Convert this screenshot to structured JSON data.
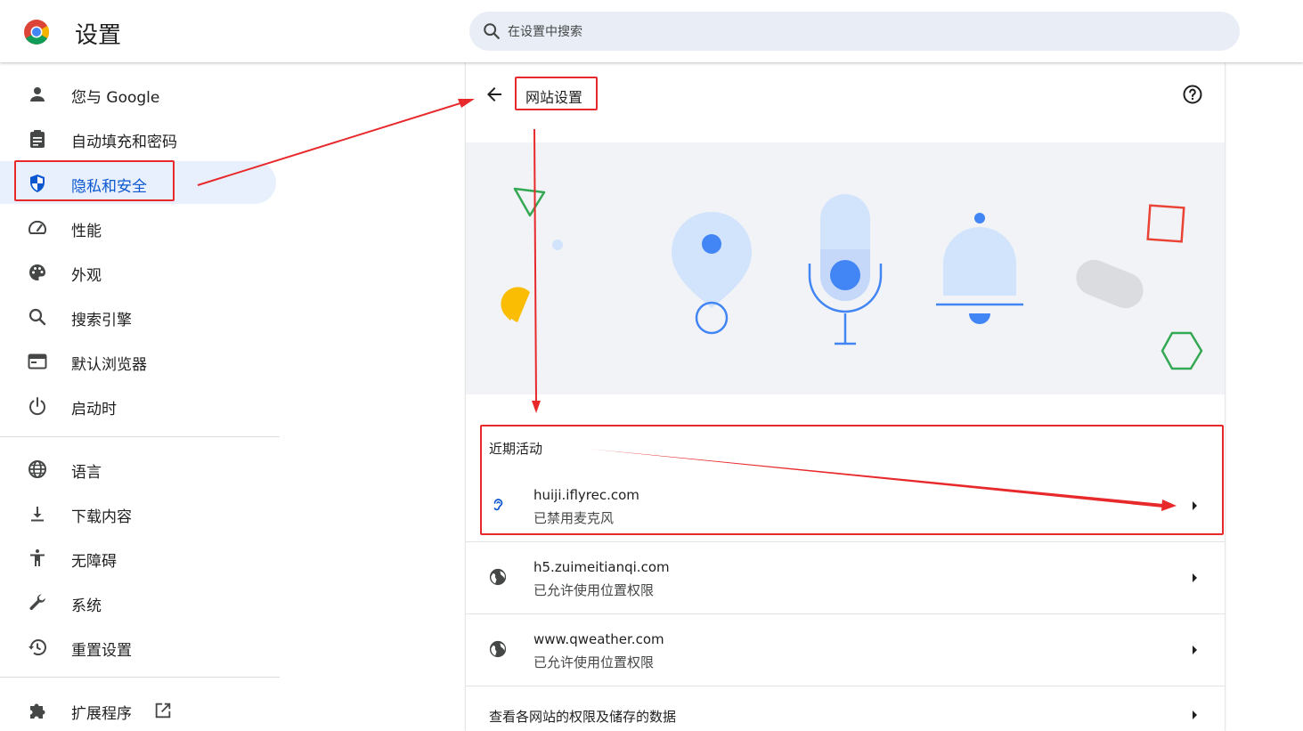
{
  "header": {
    "title": "设置",
    "search_placeholder": "在设置中搜索",
    "logo_icon": "chrome-logo-icon",
    "search_icon": "search-icon"
  },
  "sidebar": {
    "items": [
      {
        "label": "您与 Google",
        "icon": "person-icon"
      },
      {
        "label": "自动填充和密码",
        "icon": "clipboard-icon"
      },
      {
        "label": "隐私和安全",
        "icon": "shield-icon",
        "active": true
      },
      {
        "label": "性能",
        "icon": "speedometer-icon"
      },
      {
        "label": "外观",
        "icon": "palette-icon"
      },
      {
        "label": "搜索引擎",
        "icon": "search-icon"
      },
      {
        "label": "默认浏览器",
        "icon": "browser-window-icon"
      },
      {
        "label": "启动时",
        "icon": "power-icon"
      },
      {
        "label": "语言",
        "icon": "globe-icon"
      },
      {
        "label": "下载内容",
        "icon": "download-icon"
      },
      {
        "label": "无障碍",
        "icon": "accessibility-icon"
      },
      {
        "label": "系统",
        "icon": "wrench-icon"
      },
      {
        "label": "重置设置",
        "icon": "history-icon"
      },
      {
        "label": "扩展程序",
        "icon": "puzzle-icon",
        "external_icon": "open-in-new-icon"
      }
    ]
  },
  "main": {
    "title": "网站设置",
    "back_icon": "arrow-back-icon",
    "help_icon": "help-circle-icon",
    "section_title": "近期活动",
    "sites": [
      {
        "name": "huiji.iflyrec.com",
        "status": "已禁用麦克风",
        "icon": "mic-off-icon"
      },
      {
        "name": "h5.zuimeitianqi.com",
        "status": "已允许使用位置权限",
        "icon": "globe-icon"
      },
      {
        "name": "www.qweather.com",
        "status": "已允许使用位置权限",
        "icon": "globe-icon"
      }
    ],
    "all_sites_link": "查看各网站的权限及储存的数据"
  },
  "colors": {
    "accent": "#0b57d0",
    "active_bg": "#e8f0fe",
    "search_bg": "#e9eef6",
    "banner_bg": "#f2f3f7",
    "annotation_red": "#e8292b"
  }
}
